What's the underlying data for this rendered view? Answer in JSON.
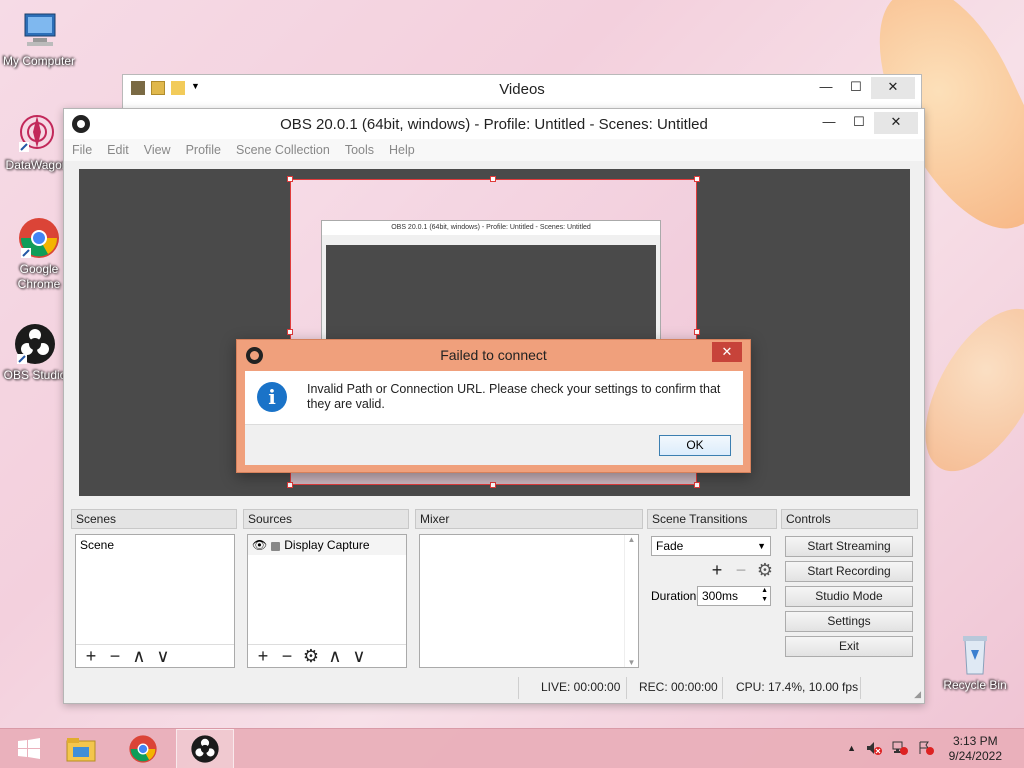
{
  "desktop": {
    "icons": [
      {
        "label": "My Computer"
      },
      {
        "label": "DataWagon"
      },
      {
        "label": "Google Chrome"
      },
      {
        "label": "OBS Studio"
      },
      {
        "label": "Recycle Bin"
      }
    ]
  },
  "videos_window": {
    "title": "Videos",
    "minimize": "—",
    "maximize": "☐",
    "close": "✕"
  },
  "obs_window": {
    "title": "OBS 20.0.1 (64bit, windows) - Profile: Untitled - Scenes: Untitled",
    "minimize": "—",
    "maximize": "☐",
    "close": "✕",
    "menu": [
      "File",
      "Edit",
      "View",
      "Profile",
      "Scene Collection",
      "Tools",
      "Help"
    ],
    "preview": {
      "mini_title": "OBS 20.0.1 (64bit, windows) - Profile: Untitled - Scenes: Untitled"
    },
    "scenes": {
      "header": "Scenes",
      "items": [
        "Scene"
      ],
      "tools": [
        "+",
        "−",
        "∧",
        "∨"
      ]
    },
    "sources": {
      "header": "Sources",
      "items": [
        {
          "label": "Display Capture",
          "visible_icon": "eye-icon",
          "lock_icon": "lock-icon"
        }
      ],
      "tools": [
        "+",
        "−",
        "⚙",
        "∧",
        "∨"
      ]
    },
    "mixer": {
      "header": "Mixer"
    },
    "scene_transitions": {
      "header": "Scene Transitions",
      "transition": "Fade",
      "tools": [
        "+",
        "−",
        "⚙"
      ],
      "duration_label": "Duration",
      "duration_value": "300ms"
    },
    "controls": {
      "header": "Controls",
      "start_streaming": "Start Streaming",
      "start_recording": "Start Recording",
      "studio_mode": "Studio Mode",
      "settings": "Settings",
      "exit": "Exit"
    },
    "status": {
      "live": "LIVE: 00:00:00",
      "rec": "REC: 00:00:00",
      "cpu": "CPU: 17.4%, 10.00 fps"
    }
  },
  "dialog": {
    "title": "Failed to connect",
    "close": "✕",
    "icon": "i",
    "message": "Invalid Path or Connection URL.  Please check your settings to confirm that they are valid.",
    "ok": "OK"
  },
  "taskbar": {
    "time": "3:13 PM",
    "date": "9/24/2022",
    "tray_arrow": "▲"
  },
  "colors": {
    "dialog_bg": "#f0a07c",
    "dialog_close": "#c7433a",
    "info_icon": "#1a73c8",
    "selection_border": "#e03b3b",
    "preview_bg": "#4a4a4a"
  }
}
